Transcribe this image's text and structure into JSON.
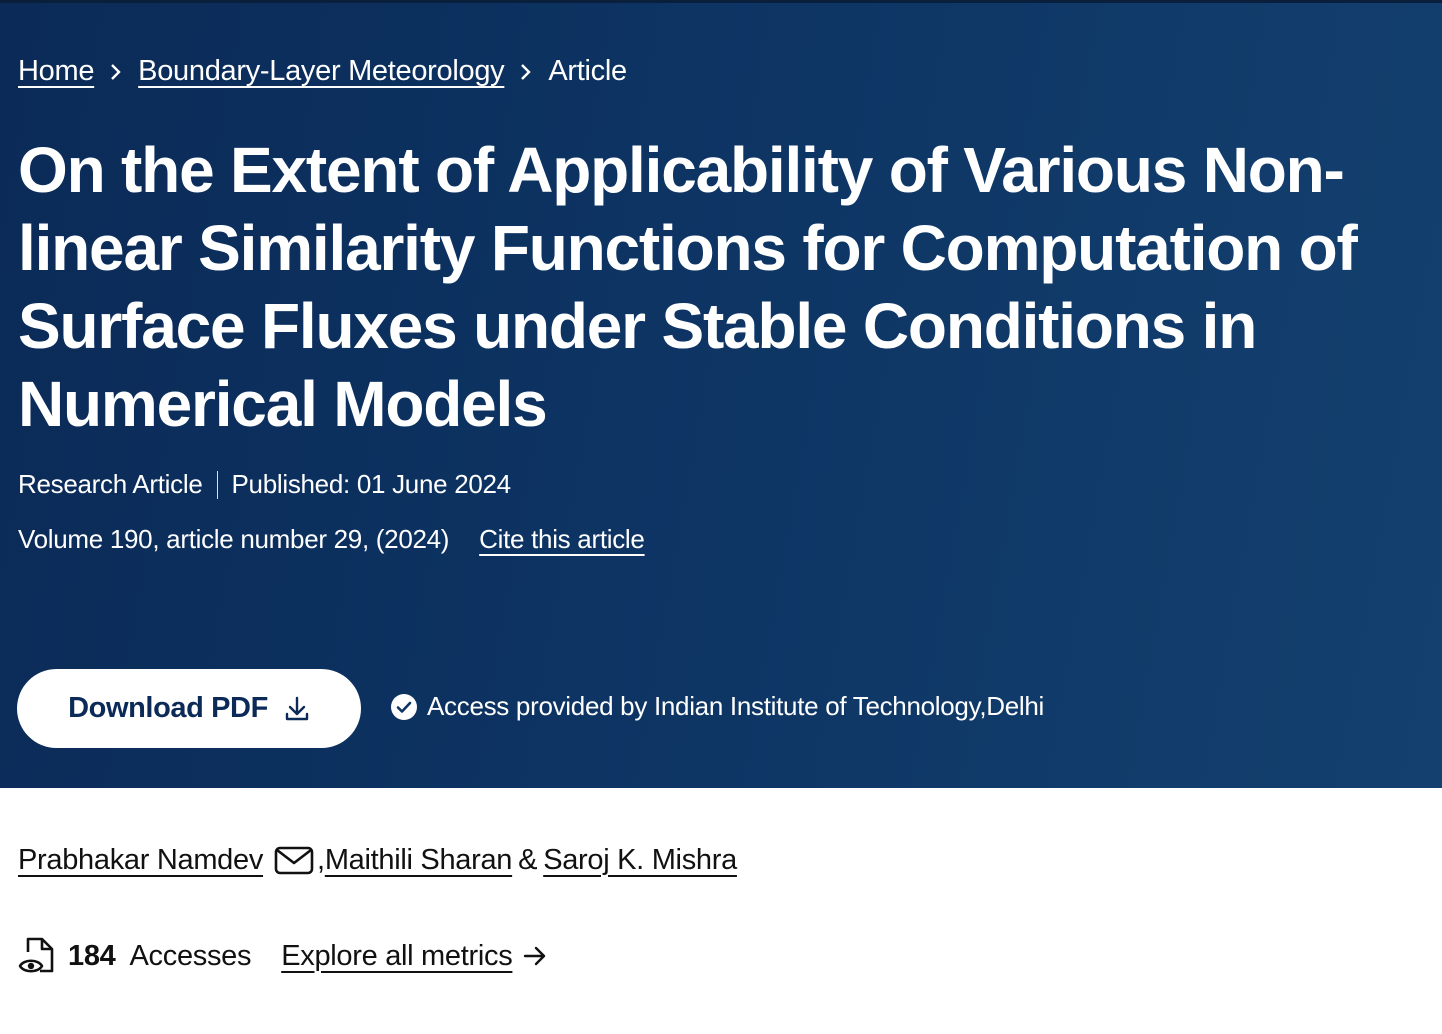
{
  "breadcrumb": {
    "home": "Home",
    "journal": "Boundary-Layer Meteorology",
    "current": "Article"
  },
  "article": {
    "title": "On the Extent of Applicability of Various Non-linear Similarity Functions for Computation of Surface Fluxes under Stable Conditions in Numerical Models",
    "type": "Research Article",
    "published": "Published: 01 June 2024",
    "volume_info": "Volume 190, article number 29, (2024)",
    "cite_link": "Cite this article"
  },
  "actions": {
    "download_label": "Download PDF",
    "access_text": "Access provided by Indian Institute of Technology,Delhi"
  },
  "authors": [
    {
      "name": "Prabhakar Namdev"
    },
    {
      "name": "Maithili Sharan"
    },
    {
      "name": "Saroj K. Mishra"
    }
  ],
  "author_separators": {
    "comma": ",",
    "amp": "&"
  },
  "metrics": {
    "accesses_count": "184",
    "accesses_label": "Accesses",
    "explore_link": "Explore all metrics"
  },
  "colors": {
    "hero_bg": "#0d3463",
    "hero_text": "#ffffff",
    "button_bg": "#ffffff",
    "button_text": "#0b2a57",
    "body_text": "#111111"
  },
  "icons": {
    "breadcrumb_separator": "chevron-right-icon",
    "download": "download-icon",
    "access": "check-circle-icon",
    "email": "email-icon",
    "accesses": "document-eye-icon",
    "explore": "arrow-right-icon"
  }
}
